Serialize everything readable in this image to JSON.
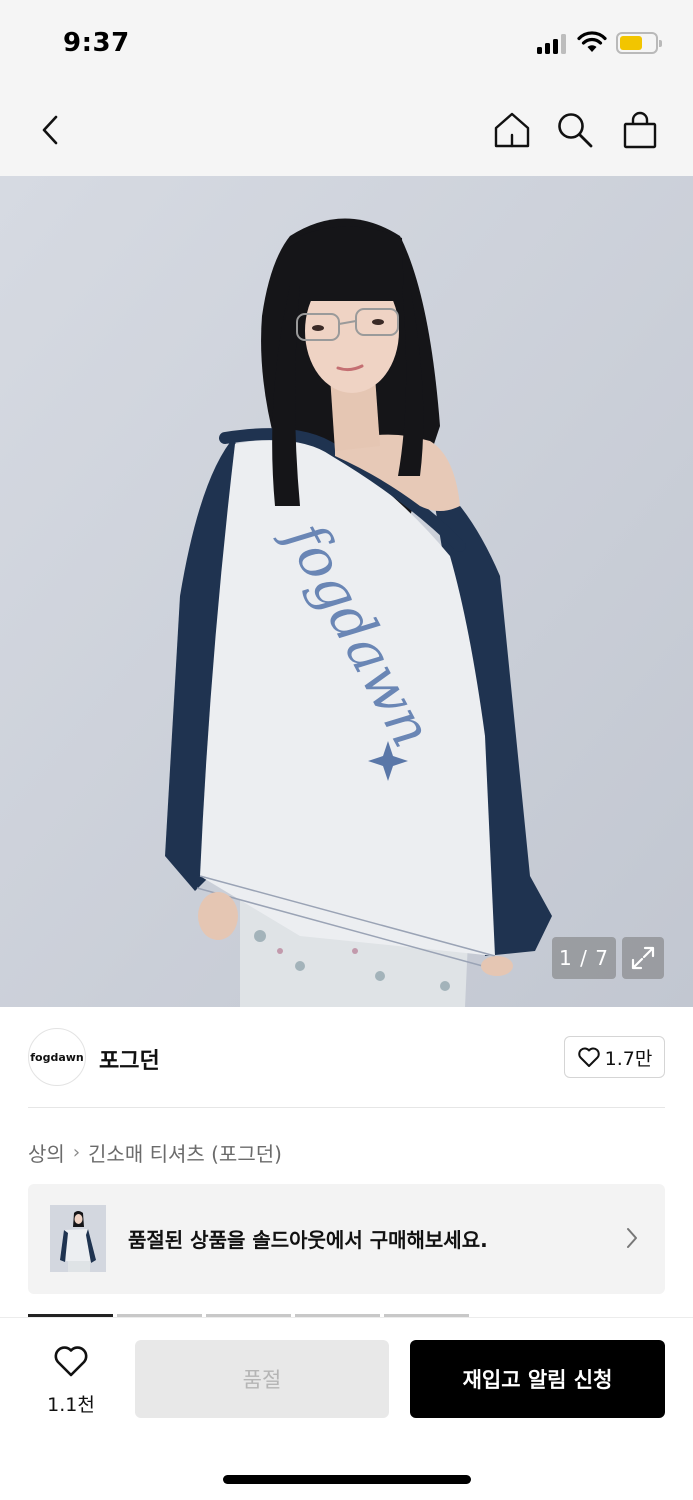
{
  "status_bar": {
    "time": "9:37",
    "battery_color": "#f2c500"
  },
  "nav": {
    "back_icon": "chevron-left-icon",
    "home_icon": "home-icon",
    "search_icon": "search-icon",
    "cart_icon": "shopping-bag-icon"
  },
  "gallery": {
    "counter": "1 / 7",
    "expand_icon": "expand-icon",
    "print_text": "fogdawn"
  },
  "brand": {
    "logo_text": "fogdawn",
    "name": "포그던",
    "likes": "1.7만"
  },
  "breadcrumb": {
    "category": "상의",
    "subcategory": "긴소매 티셔츠 (포그던)"
  },
  "soldout_banner": {
    "text": "품절된 상품을 솔드아웃에서 구매해보세요."
  },
  "bottom_bar": {
    "wish_count": "1.1천",
    "soldout_label": "품절",
    "restock_label": "재입고 알림 신청",
    "primary_color": "#000000"
  }
}
